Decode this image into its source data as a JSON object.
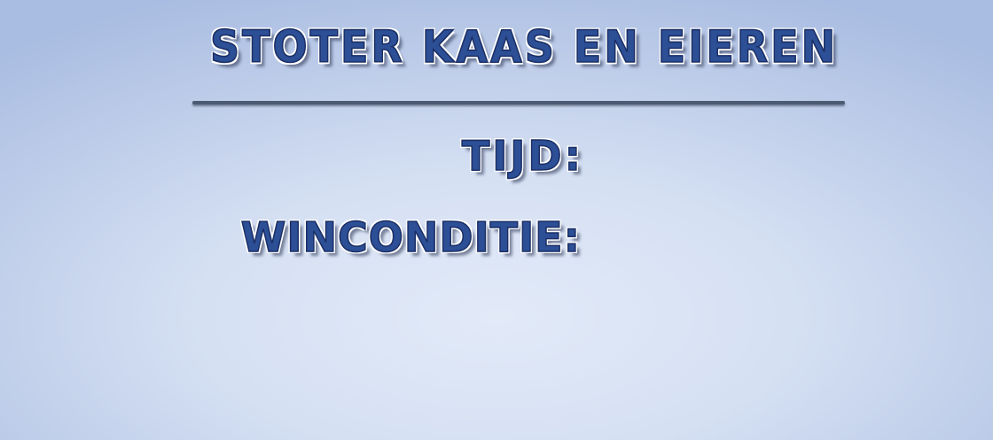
{
  "title": "STOTER KAAS EN EIEREN",
  "labels": {
    "time": "TIJD:",
    "win_condition": "WINCONDITIE:"
  },
  "colors": {
    "text": "#2c4f96",
    "divider": "#4c5a72",
    "background": "#d5e0f3"
  }
}
